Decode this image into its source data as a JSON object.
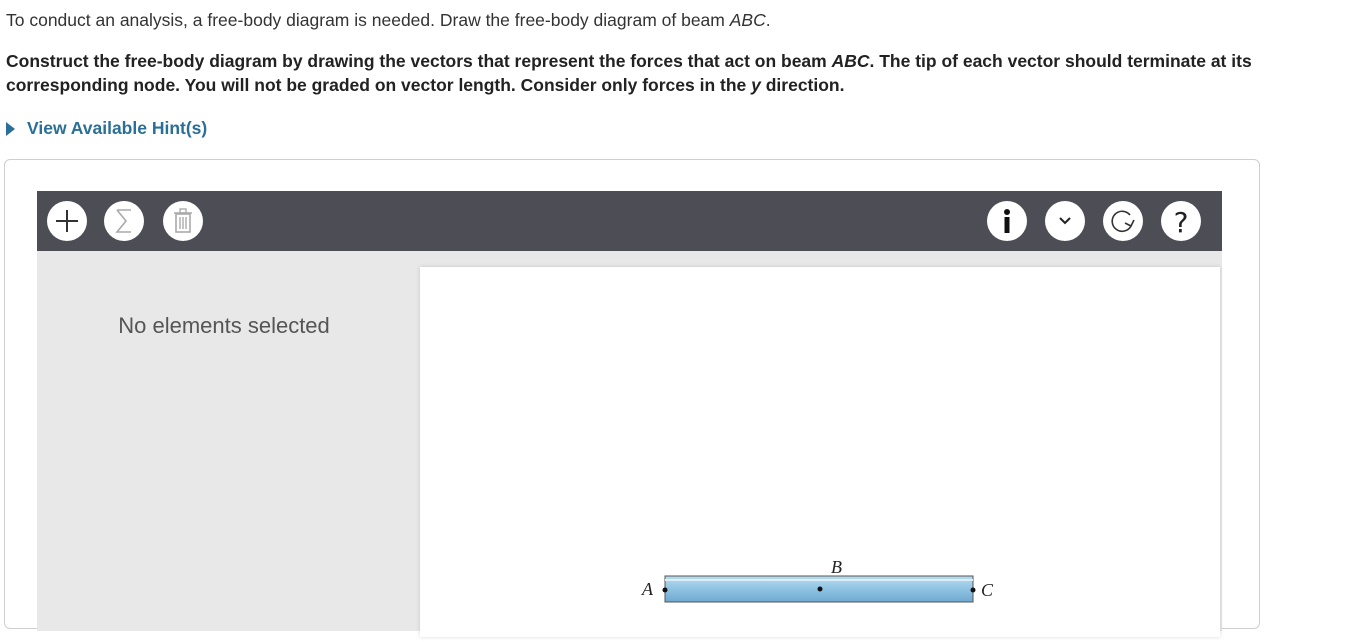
{
  "instructions": {
    "p1_text": "To conduct an analysis, a free-body diagram is needed. Draw the free-body diagram of beam ",
    "p1_italic": "ABC",
    "p1_end": ".",
    "p2_a": "Construct the free-body diagram by drawing the vectors that represent the forces that act on beam ",
    "p2_italic1": "ABC",
    "p2_b": ". The tip of each vector should terminate at its corresponding node. You will not be graded on vector length. Consider only forces in the ",
    "p2_italic2": "y",
    "p2_c": " direction."
  },
  "hint": {
    "label": "View Available Hint(s)"
  },
  "toolbar": {
    "left_icons": [
      "plus-icon",
      "sigma-icon",
      "trash-icon"
    ],
    "right_icons": [
      "info-icon",
      "chevron-down-icon",
      "reset-icon",
      "help-icon"
    ]
  },
  "side_panel": {
    "empty_text": "No elements selected"
  },
  "diagram": {
    "node_a": "A",
    "node_b": "B",
    "node_c": "C",
    "beam_color": "#8fc3e3"
  }
}
